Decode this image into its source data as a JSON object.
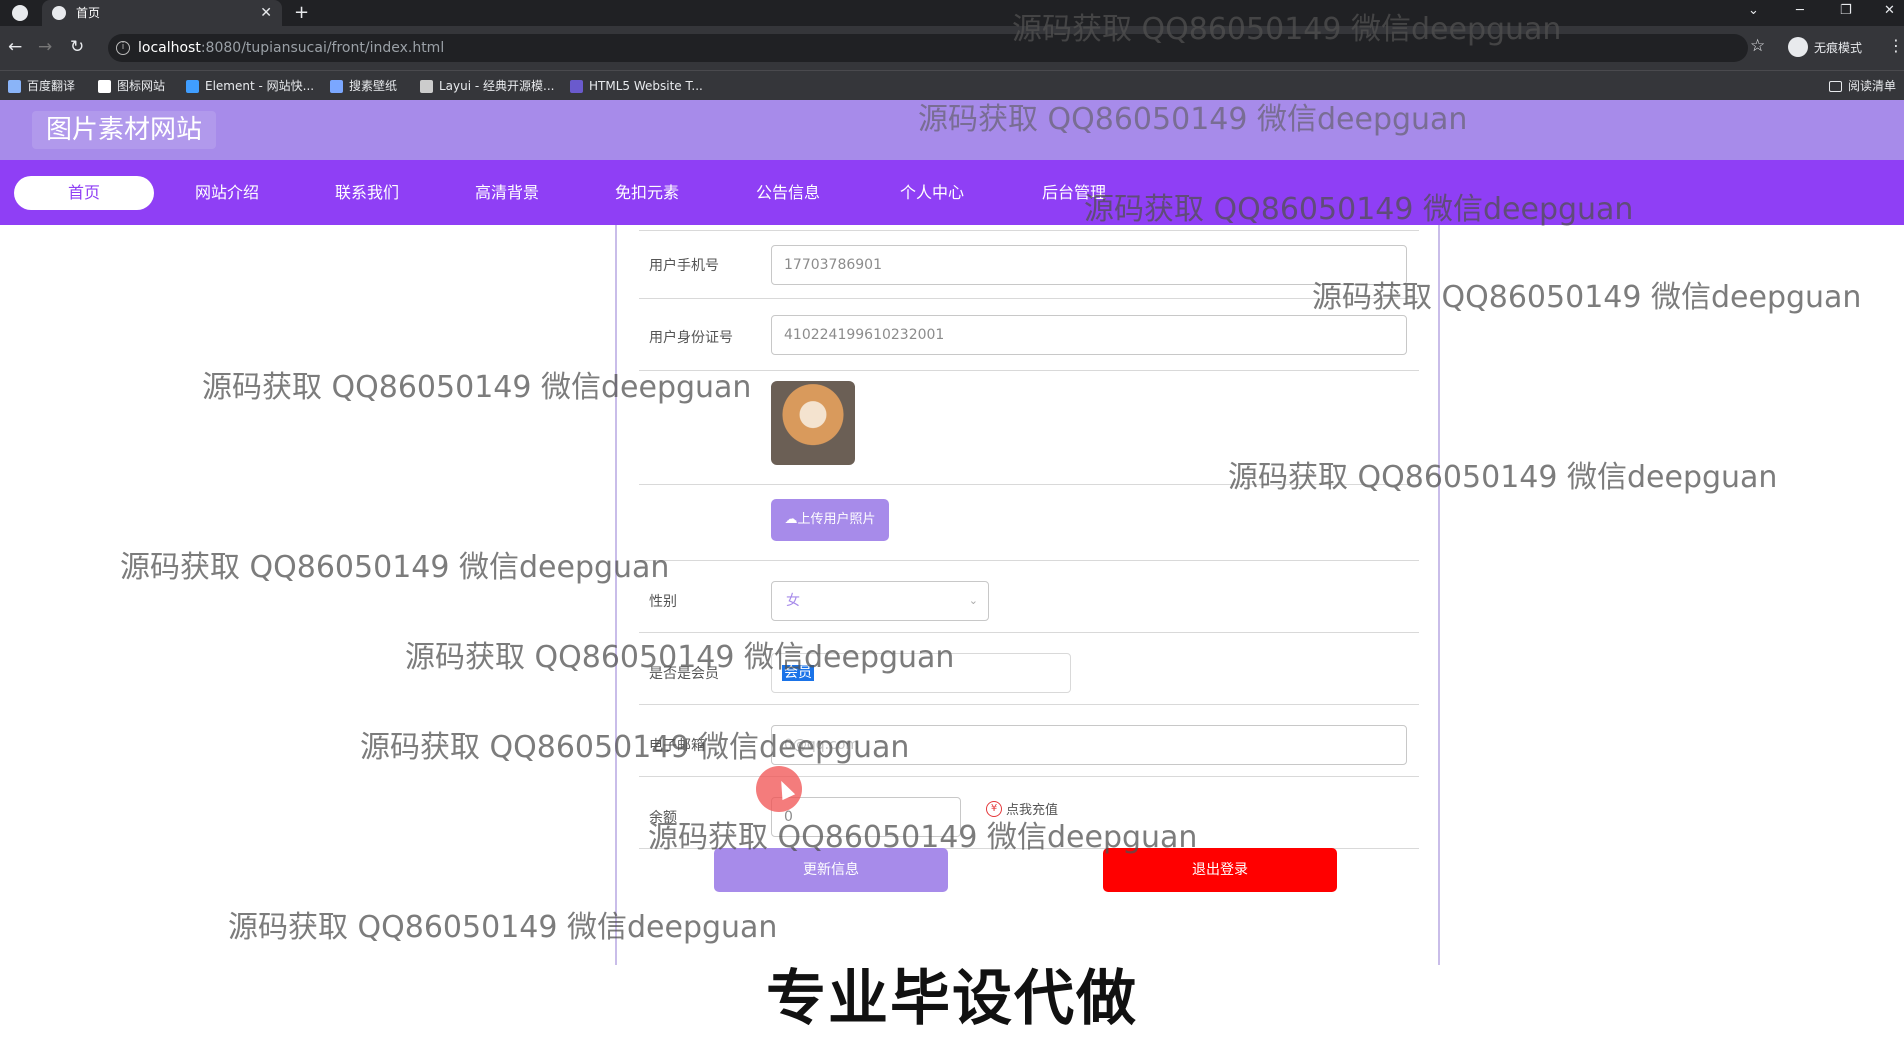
{
  "browser": {
    "tab_title": "首页",
    "new_tab": "+",
    "url_host": "localhost",
    "url_path": ":8080/tupiansucai/front/index.html",
    "incognito_label": "无痕模式",
    "bookmarks": [
      "百度翻译",
      "图标网站",
      "Element - 网站快...",
      "搜素壁纸",
      "Layui - 经典开源模...",
      "HTML5 Website T..."
    ],
    "reading_list": "阅读清单"
  },
  "site": {
    "title": "图片素材网站",
    "nav": [
      "首页",
      "网站介绍",
      "联系我们",
      "高清背景",
      "免扣元素",
      "公告信息",
      "个人中心",
      "后台管理"
    ],
    "active_nav": "首页"
  },
  "form": {
    "phone_label": "用户手机号",
    "phone_value": "17703786901",
    "idcard_label": "用户身份证号",
    "idcard_value": "410224199610232001",
    "upload_button": "上传用户照片",
    "gender_label": "性别",
    "gender_value": "女",
    "member_label": "是否是会员",
    "member_value": "会员",
    "email_label": "电子邮箱",
    "email_value": "0@qq.com",
    "balance_label": "余额",
    "balance_value": "0",
    "recharge_label": "点我充值",
    "update_button": "更新信息",
    "logout_button": "退出登录"
  },
  "watermark_text": "源码获取 QQ86050149 微信deepguan",
  "banner_text": "专业毕设代做"
}
